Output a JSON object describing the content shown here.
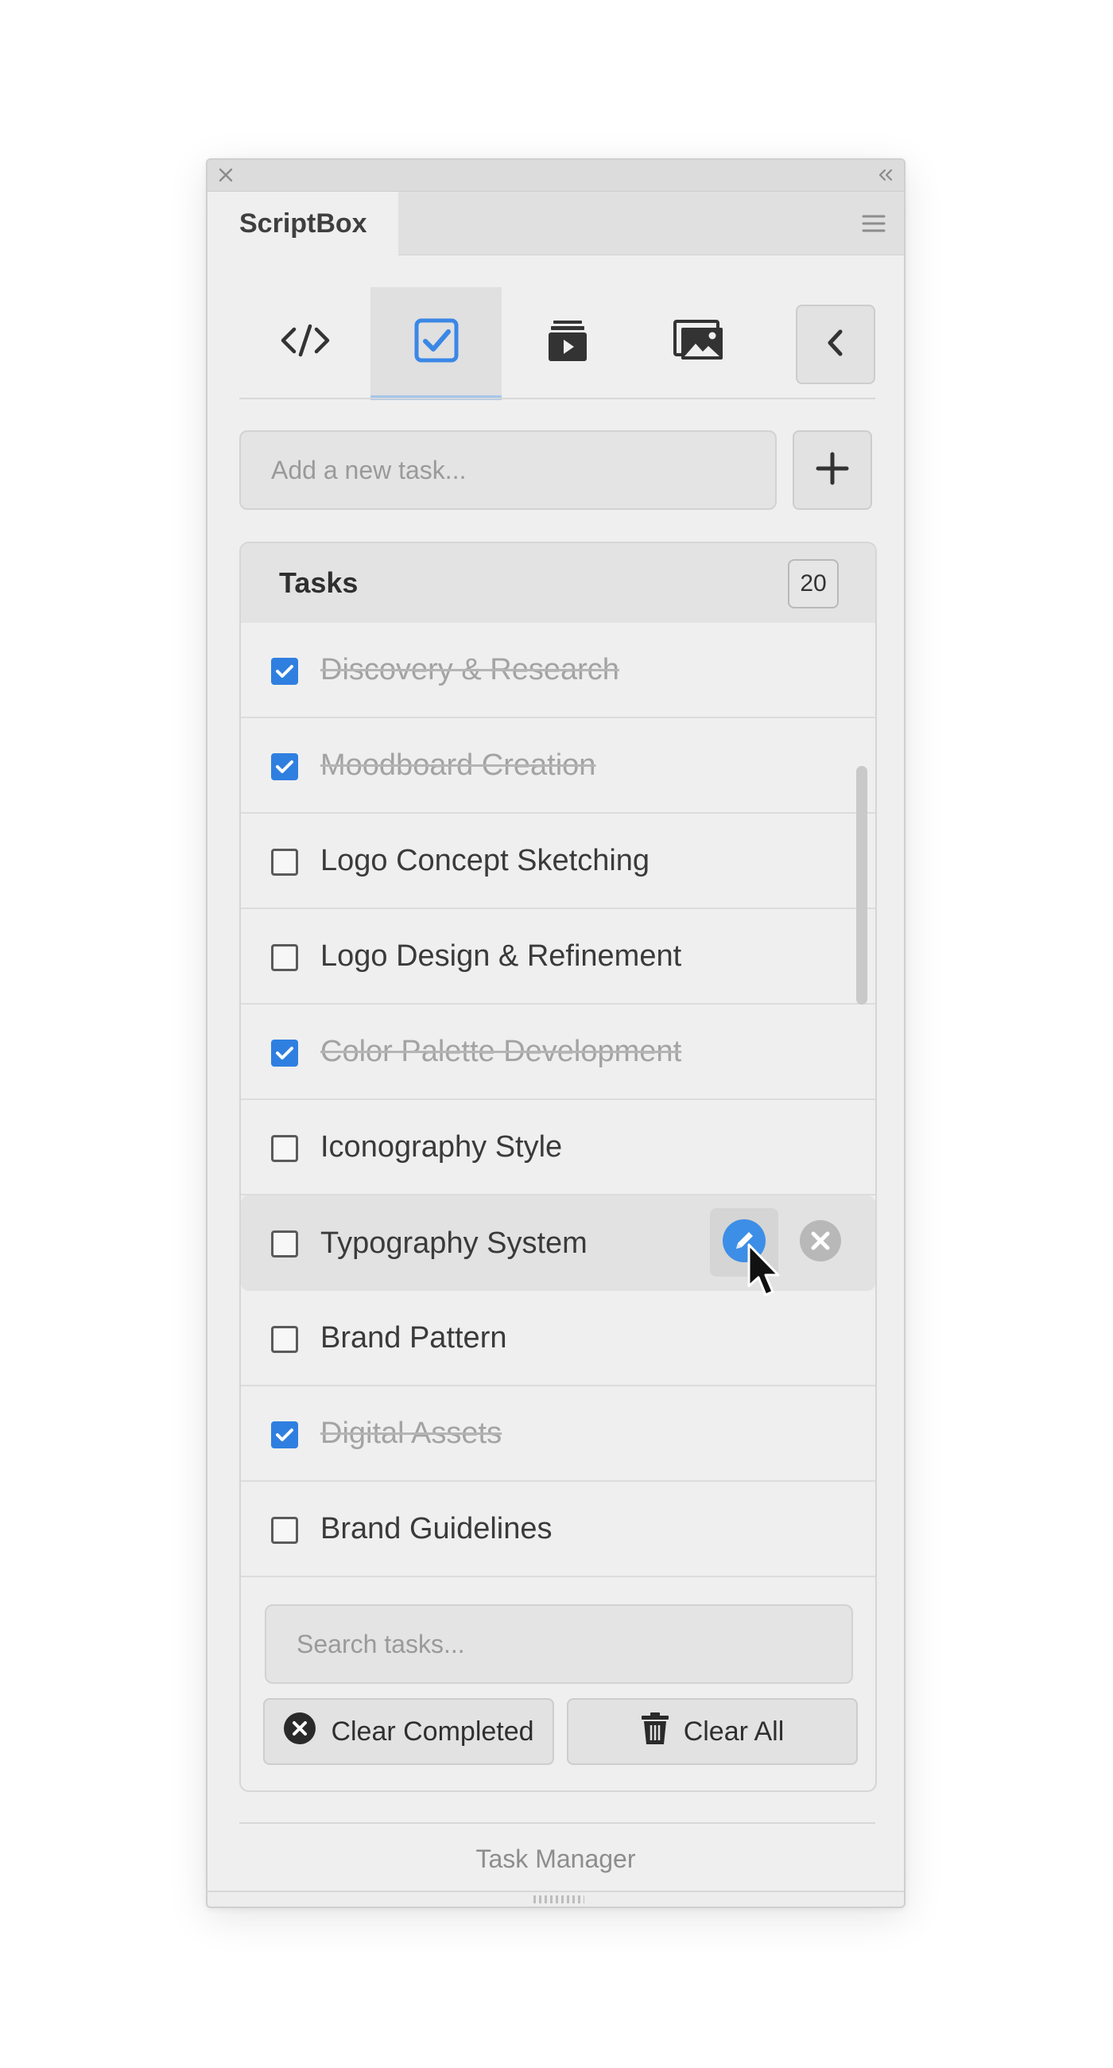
{
  "panel": {
    "title": "ScriptBox",
    "footer": "Task Manager"
  },
  "toolbar": {
    "tabs": [
      {
        "icon": "code-icon",
        "active": false
      },
      {
        "icon": "checkbox-icon",
        "active": true
      },
      {
        "icon": "media-stack-icon",
        "active": false
      },
      {
        "icon": "image-icon",
        "active": false
      }
    ],
    "collapse_icon": "chevron-left-icon"
  },
  "add_task": {
    "placeholder": "Add a new task...",
    "button_icon": "plus-icon"
  },
  "tasks": {
    "header": "Tasks",
    "count": "20",
    "items": [
      {
        "label": "Discovery & Research",
        "done": true
      },
      {
        "label": "Moodboard Creation",
        "done": true
      },
      {
        "label": "Logo Concept Sketching",
        "done": false
      },
      {
        "label": "Logo Design & Refinement",
        "done": false
      },
      {
        "label": "Color Palette Development",
        "done": true
      },
      {
        "label": "Iconography Style",
        "done": false
      },
      {
        "label": "Typography System",
        "done": false
      },
      {
        "label": "Brand Pattern",
        "done": false
      },
      {
        "label": "Digital Assets",
        "done": true
      },
      {
        "label": "Brand Guidelines",
        "done": false
      }
    ],
    "search_placeholder": "Search tasks...",
    "clear_completed_label": "Clear Completed",
    "clear_all_label": "Clear All"
  },
  "colors": {
    "accent": "#2f7fe0",
    "edit_icon": "#3d8ee6",
    "delete_icon": "#b8b8b8"
  }
}
